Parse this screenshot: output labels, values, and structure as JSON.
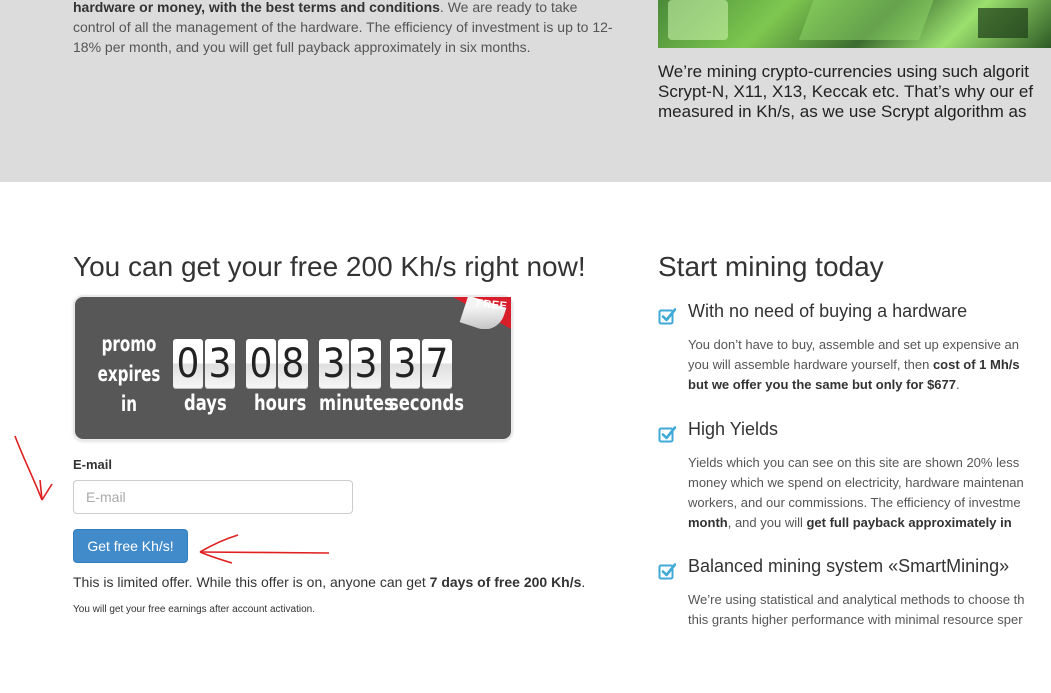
{
  "top": {
    "left_bold": "hardware or money, with the best terms and conditions",
    "left_rest": ". We are ready to take control of all the management of the hardware. The efficiency of investment is up to 12-18% per month, and you will get full payback approximately in six months.",
    "right_line1": "We’re mining crypto-currencies using such algorit",
    "right_line2": "Scrypt-N, X11, X13, Keccak etc. That’s why our ef",
    "right_line3": "measured in Kh/s, as we use Scrypt algorithm as"
  },
  "promo": {
    "heading": "You can get your free 200 Kh/s right now!",
    "label_line1": "promo",
    "label_line2": "expires",
    "label_line3": "in",
    "ribbon": "FREE",
    "days": [
      "0",
      "3"
    ],
    "hours": [
      "0",
      "8"
    ],
    "minutes": [
      "3",
      "3"
    ],
    "seconds": [
      "3",
      "7"
    ],
    "days_label": "days",
    "hours_label": "hours",
    "minutes_label": "minutes",
    "seconds_label": "seconds"
  },
  "form": {
    "email_label": "E-mail",
    "email_placeholder": "E-mail",
    "email_value": "",
    "button_label": "Get free Kh/s!",
    "offer_prefix": "This is limited offer. While this offer is on, anyone can get ",
    "offer_bold": "7 days of free 200 Kh/s",
    "offer_suffix": ".",
    "note": "You will get your free earnings after account activation."
  },
  "start": {
    "heading": "Start mining today",
    "features": [
      {
        "title": "With no need of buying a hardware",
        "line1": "You don’t have to buy, assemble and set up expensive an",
        "line2_text": "you will assemble hardware yourself, then ",
        "line2_bold": "cost of 1 Mh/s",
        "line3_bold": "but we offer you the same but only for $677",
        "line3_text": "."
      },
      {
        "title": "High Yields",
        "line1": "Yields which you can see on this site are shown 20% less",
        "line2": "money which we spend on electricity, hardware maintenan",
        "line3": "workers, and our commissions. The efficiency of investme",
        "line4_bold1": "month",
        "line4_text": ", and you will ",
        "line4_bold2": "get full payback approximately in"
      },
      {
        "title": "Balanced mining system «SmartMining»",
        "line1": "We’re using statistical and analytical methods to choose th",
        "line2": "this grants higher performance with minimal resource sper"
      }
    ]
  },
  "colors": {
    "accent": "#428bca",
    "check": "#3fa9d8",
    "annotation_arrow": "#e02020"
  }
}
